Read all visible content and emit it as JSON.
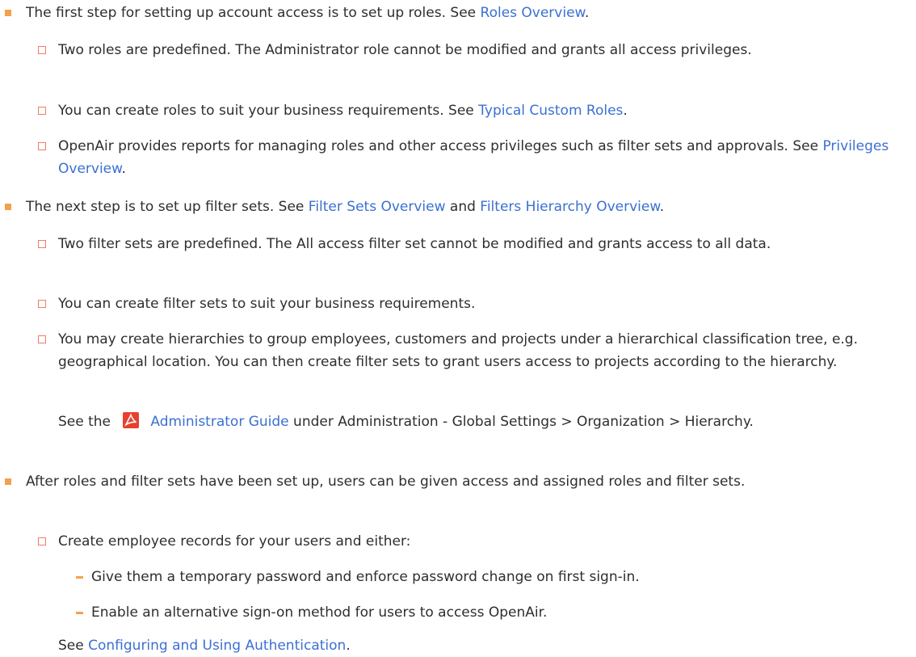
{
  "items": [
    {
      "pre": "The first step for setting up account access is to set up roles. See ",
      "link1": "Roles Overview",
      "post": "."
    },
    {
      "text": "Two roles are predefined. The Administrator role cannot be modified and grants all access privileges."
    },
    {
      "pre": "You can create roles to suit your business requirements. See ",
      "link1": "Typical Custom Roles",
      "post": "."
    },
    {
      "pre": "OpenAir provides reports for managing roles and other access privileges such as filter sets and approvals. See ",
      "link1": "Privileges Overview",
      "post": "."
    },
    {
      "pre": "The next step is to set up filter sets. See ",
      "link1": "Filter Sets Overview",
      "mid": " and ",
      "link2": "Filters Hierarchy Overview",
      "post": "."
    },
    {
      "text": "Two filter sets are predefined. The All access filter set cannot be modified and grants access to all data."
    },
    {
      "text": "You can create filter sets to suit your business requirements."
    },
    {
      "text": "You may create hierarchies to group employees, customers and projects under a hierarchical classification tree, e.g. geographical location. You can then create filter sets to grant users access to projects according to the hierarchy."
    },
    {
      "pre": "See the ",
      "icon": "pdf-icon",
      "link1": "Administrator Guide",
      "post": " under Administration - Global Settings > Organization > Hierarchy."
    },
    {
      "text": "After roles and filter sets have been set up, users can be given access and assigned roles and filter sets."
    },
    {
      "text": "Create employee records for your users and either:"
    },
    {
      "text": "Give them a temporary password and enforce password change on first sign-in."
    },
    {
      "text": "Enable an alternative sign-on method for users to access OpenAir."
    },
    {
      "pre": "See ",
      "link1": "Configuring and Using Authentication",
      "post": "."
    }
  ],
  "colors": {
    "text": "#2e2e2e",
    "link": "#3b70d1",
    "bullet": "#f3a14b",
    "sub_bullet": "#ef7c6c",
    "pdf_icon": "#e8402f"
  }
}
